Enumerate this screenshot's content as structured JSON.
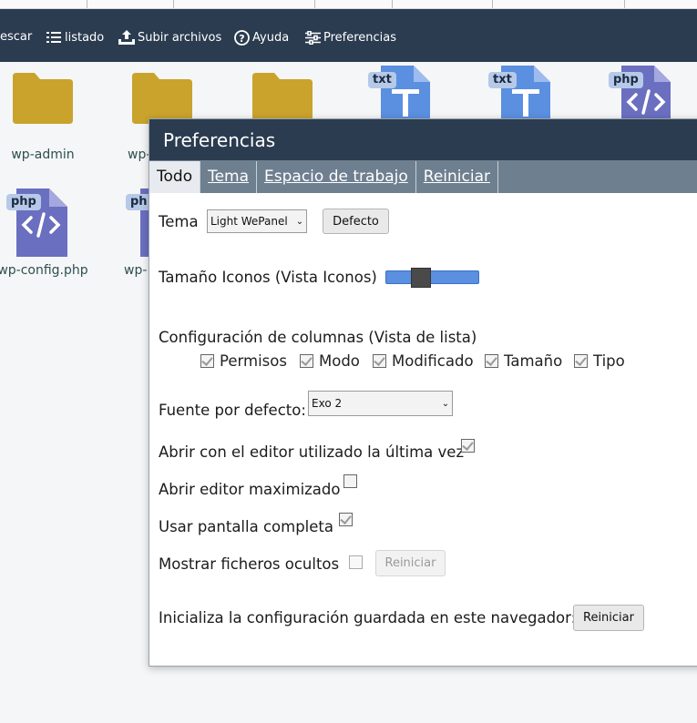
{
  "toolbar": {
    "items": [
      {
        "label": "escar",
        "icon": "download-icon"
      },
      {
        "label": "listado",
        "icon": "list-icon"
      },
      {
        "label": "Subir archivos",
        "icon": "upload-icon"
      },
      {
        "label": "Ayuda",
        "icon": "help-icon"
      },
      {
        "label": "Preferencias",
        "icon": "sliders-icon"
      }
    ]
  },
  "files": {
    "row1": [
      {
        "name": "wp-admin",
        "type": "folder"
      },
      {
        "name": "wp-",
        "type": "folder"
      },
      {
        "name": "",
        "type": "folder"
      },
      {
        "name": "",
        "type": "txt",
        "badge": "txt"
      },
      {
        "name": "",
        "type": "txt",
        "badge": "txt"
      },
      {
        "name": "",
        "type": "php",
        "badge": "php"
      }
    ],
    "row2": [
      {
        "name": "wp-config.php",
        "type": "php",
        "badge": "php"
      },
      {
        "name": "wp-",
        "type": "php",
        "badge": "ph"
      }
    ]
  },
  "dialog": {
    "title": "Preferencias",
    "tabs": [
      "Todo",
      "Tema",
      "Espacio de trabajo",
      "Reiniciar"
    ],
    "active_tab": "Todo",
    "theme": {
      "label": "Tema",
      "value": "Light WePanel",
      "default_button": "Defecto"
    },
    "icon_size": {
      "label": "Tamaño Iconos (Vista Iconos)",
      "value_fraction": 0.34
    },
    "columns": {
      "label": "Configuración de columnas (Vista de lista)",
      "options": [
        {
          "label": "Permisos",
          "checked": true
        },
        {
          "label": "Modo",
          "checked": true
        },
        {
          "label": "Modificado",
          "checked": true
        },
        {
          "label": "Tamaño",
          "checked": true
        },
        {
          "label": "Tipo",
          "checked": true
        }
      ]
    },
    "font": {
      "label": "Fuente por defecto:",
      "value": "Exo 2"
    },
    "open_last_editor": {
      "label": "Abrir con el editor utilizado la última vez",
      "checked": true
    },
    "open_maximized": {
      "label": "Abrir editor maximizado",
      "checked": false
    },
    "fullscreen": {
      "label": "Usar pantalla completa",
      "checked": true
    },
    "hidden_files": {
      "label": "Mostrar ficheros ocultos",
      "checked": false,
      "reset_button": "Reiniciar"
    },
    "reset_all": {
      "label": "Inicializa la configuración guardada en este navegador:",
      "button": "Reiniciar"
    }
  },
  "colors": {
    "toolbar_bg": "#2b3c50",
    "folder": "#c9a32c",
    "txt_doc": "#5b8fe0",
    "php_doc": "#6b6fc0",
    "badge": "#b6c9e8"
  }
}
